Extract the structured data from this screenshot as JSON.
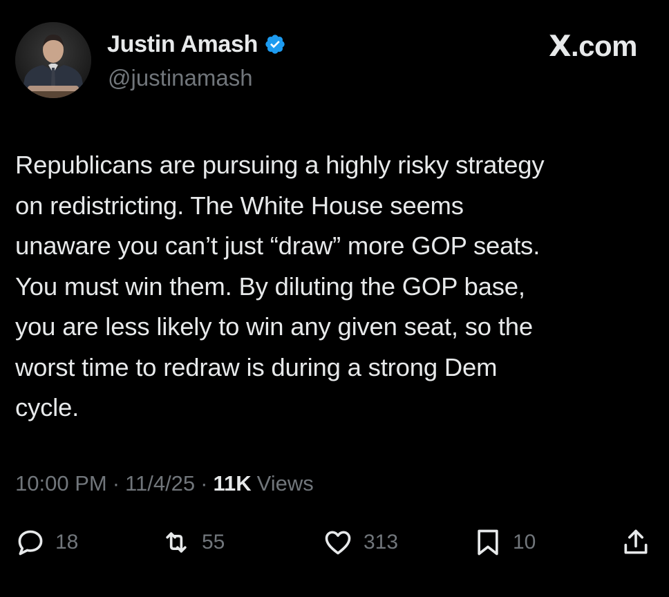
{
  "header": {
    "display_name": "Justin Amash",
    "handle": "@justinamash",
    "verified_icon": "verified-badge-icon",
    "brand": "com",
    "brand_prefix": "X",
    "brand_dot": "."
  },
  "tweet": {
    "text": "Republicans are pursuing a highly risky strategy\non redistricting. The White House seems\nunaware you can’t just “draw” more GOP seats.\nYou must win them. By diluting the GOP base,\nyou are less likely to win any given seat, so the\nworst time to redraw is during a strong Dem\ncycle."
  },
  "meta": {
    "time": "10:00 PM",
    "date": "11/4/25",
    "separator": "·",
    "views_count": "11K",
    "views_label": "Views"
  },
  "actions": {
    "reply": {
      "icon": "reply-icon",
      "count": "18"
    },
    "retweet": {
      "icon": "retweet-icon",
      "count": "55"
    },
    "like": {
      "icon": "heart-icon",
      "count": "313"
    },
    "bookmark": {
      "icon": "bookmark-icon",
      "count": "10"
    },
    "share": {
      "icon": "share-icon"
    }
  },
  "colors": {
    "background": "#000000",
    "primary_text": "#e7e9ea",
    "secondary_text": "#71767b",
    "verified_blue": "#1d9bf0"
  }
}
